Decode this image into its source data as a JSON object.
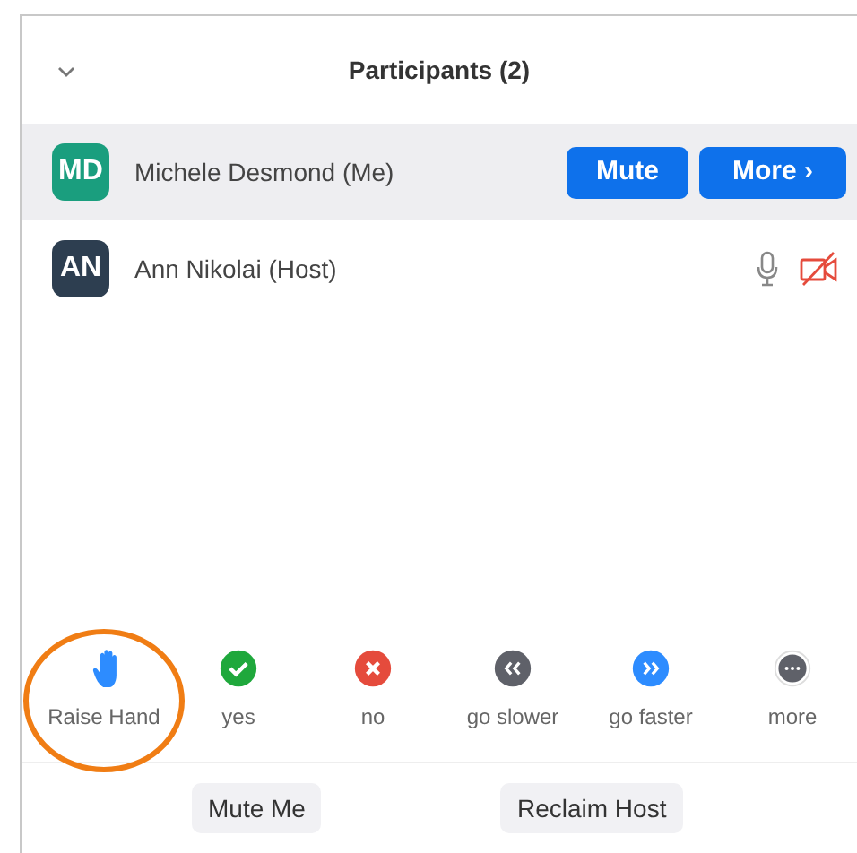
{
  "panel": {
    "title": "Participants (2)"
  },
  "participants": [
    {
      "initials": "MD",
      "color": "#1a9e7e",
      "name": "Michele Desmond (Me)",
      "selected": true,
      "kind": "buttons",
      "buttons": [
        "Mute",
        "More ›"
      ]
    },
    {
      "initials": "AN",
      "color": "#2d3e50",
      "name": "Ann Nikolai (Host)",
      "selected": false,
      "kind": "status",
      "video_off": true
    }
  ],
  "reactions": [
    {
      "kind": "hand",
      "label": "Raise Hand",
      "color": "#2d8cff",
      "circled": true
    },
    {
      "kind": "check",
      "label": "yes",
      "color": "#1fa83c",
      "circled": false
    },
    {
      "kind": "cross",
      "label": "no",
      "color": "#e54b3c",
      "circled": false
    },
    {
      "kind": "slower",
      "label": "go slower",
      "color": "#5f6169",
      "circled": false
    },
    {
      "kind": "faster",
      "label": "go faster",
      "color": "#2d8cff",
      "circled": false
    },
    {
      "kind": "more",
      "label": "more",
      "color": "#5f6169",
      "circled": false
    }
  ],
  "footer_buttons": [
    "Mute Me",
    "Reclaim Host"
  ]
}
